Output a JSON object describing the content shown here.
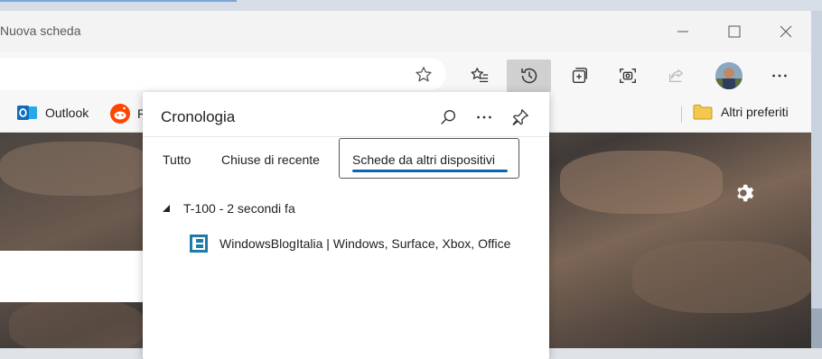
{
  "window": {
    "tab_title": "Nuova scheda"
  },
  "favorites": [
    {
      "label": "Outlook",
      "icon": "outlook-icon"
    },
    {
      "label": "R",
      "icon": "reddit-icon"
    }
  ],
  "favorites_other": {
    "label": "Altri preferiti",
    "icon": "folder-icon"
  },
  "history": {
    "title": "Cronologia",
    "tabs": [
      "Tutto",
      "Chiuse di recente",
      "Schede da altri dispositivi"
    ],
    "active_tab": "Schede da altri dispositivi",
    "device": {
      "label": "T-100 - 2 secondi fa"
    },
    "pages": [
      {
        "title": "WindowsBlogItalia | Windows, Surface, Xbox, Office",
        "icon": "windowsblogitalia-icon"
      }
    ]
  },
  "colors": {
    "accent": "#0a64b4",
    "outlook": "#0f6cbd",
    "reddit": "#ff4500",
    "folder": "#f2c94c"
  }
}
